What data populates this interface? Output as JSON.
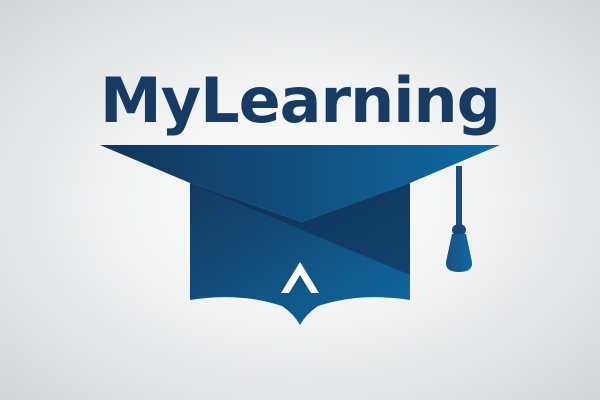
{
  "logo": {
    "text": "MyLearning",
    "icon": "graduation-cap-icon",
    "colors": {
      "text": "#173b63",
      "cap_dark": "#102c4c",
      "cap_mid": "#1a4a7a",
      "cap_light": "#0f6aa3",
      "background_center": "#ffffff",
      "background_edge": "#d4d6d8",
      "chevron": "#ffffff"
    }
  }
}
